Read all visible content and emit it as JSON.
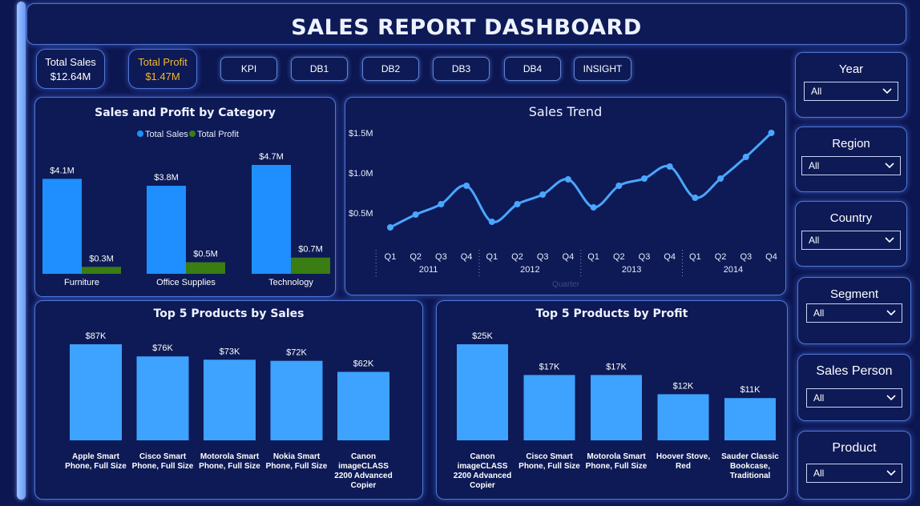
{
  "header": {
    "title": "SALES REPORT DASHBOARD"
  },
  "kpis": [
    {
      "label": "Total Sales",
      "value": "$12.64M",
      "color": "#ffffff"
    },
    {
      "label": "Total Profit",
      "value": "$1.47M",
      "color": "#f2b830"
    }
  ],
  "nav": [
    "KPI",
    "DB1",
    "DB2",
    "DB3",
    "DB4",
    "INSIGHT"
  ],
  "slicers": [
    {
      "label": "Year",
      "value": "All"
    },
    {
      "label": "Region",
      "value": "All"
    },
    {
      "label": "Country",
      "value": "All"
    },
    {
      "label": "Segment",
      "value": "All"
    },
    {
      "label": "Sales Person",
      "value": "All"
    },
    {
      "label": "Product",
      "value": "All"
    }
  ],
  "colors": {
    "sales": "#1f8fff",
    "profit": "#3a7d12",
    "trend": "#4aa6ff",
    "bars": "#3ea2ff",
    "border": "#4f78d6"
  },
  "chart_data": [
    {
      "type": "bar",
      "title": "Sales and Profit by Category",
      "categories": [
        "Furniture",
        "Office Supplies",
        "Technology"
      ],
      "series": [
        {
          "name": "Total Sales",
          "values": [
            4.1,
            3.8,
            4.7
          ],
          "labels": [
            "$4.1M",
            "$3.8M",
            "$4.7M"
          ]
        },
        {
          "name": "Total Profit",
          "values": [
            0.3,
            0.5,
            0.7
          ],
          "labels": [
            "$0.3M",
            "$0.5M",
            "$0.7M"
          ]
        }
      ],
      "ylim": [
        0,
        4.7
      ],
      "legend": "top-center"
    },
    {
      "type": "line",
      "title": "Sales Trend",
      "xlabel": "Quarter",
      "years": [
        "2011",
        "2012",
        "2013",
        "2014"
      ],
      "quarters": [
        "Q1",
        "Q2",
        "Q3",
        "Q4"
      ],
      "values": [
        0.32,
        0.48,
        0.61,
        0.84,
        0.39,
        0.61,
        0.73,
        0.92,
        0.57,
        0.84,
        0.93,
        1.08,
        0.69,
        0.93,
        1.2,
        1.5
      ],
      "yticks": [
        0.5,
        1.0,
        1.5
      ],
      "ytick_labels": [
        "$0.5M",
        "$1.0M",
        "$1.5M"
      ],
      "ylim": [
        0.2,
        1.55
      ]
    },
    {
      "type": "bar",
      "title": "Top 5 Products by Sales",
      "categories": [
        [
          "Apple Smart",
          "Phone, Full Size"
        ],
        [
          "Cisco Smart",
          "Phone, Full Size"
        ],
        [
          "Motorola Smart",
          "Phone, Full Size"
        ],
        [
          "Nokia Smart",
          "Phone, Full Size"
        ],
        [
          "Canon",
          "imageCLASS",
          "2200 Advanced",
          "Copier"
        ]
      ],
      "values": [
        87,
        76,
        73,
        72,
        62
      ],
      "labels": [
        "$87K",
        "$76K",
        "$73K",
        "$72K",
        "$62K"
      ],
      "ylim": [
        0,
        87
      ]
    },
    {
      "type": "bar",
      "title": "Top 5 Products by Profit",
      "categories": [
        [
          "Canon",
          "imageCLASS",
          "2200 Advanced",
          "Copier"
        ],
        [
          "Cisco Smart",
          "Phone, Full Size"
        ],
        [
          "Motorola Smart",
          "Phone, Full Size"
        ],
        [
          "Hoover Stove,",
          "Red"
        ],
        [
          "Sauder Classic",
          "Bookcase,",
          "Traditional"
        ]
      ],
      "values": [
        25,
        17,
        17,
        12,
        11
      ],
      "labels": [
        "$25K",
        "$17K",
        "$17K",
        "$12K",
        "$11K"
      ],
      "ylim": [
        0,
        25
      ]
    }
  ]
}
